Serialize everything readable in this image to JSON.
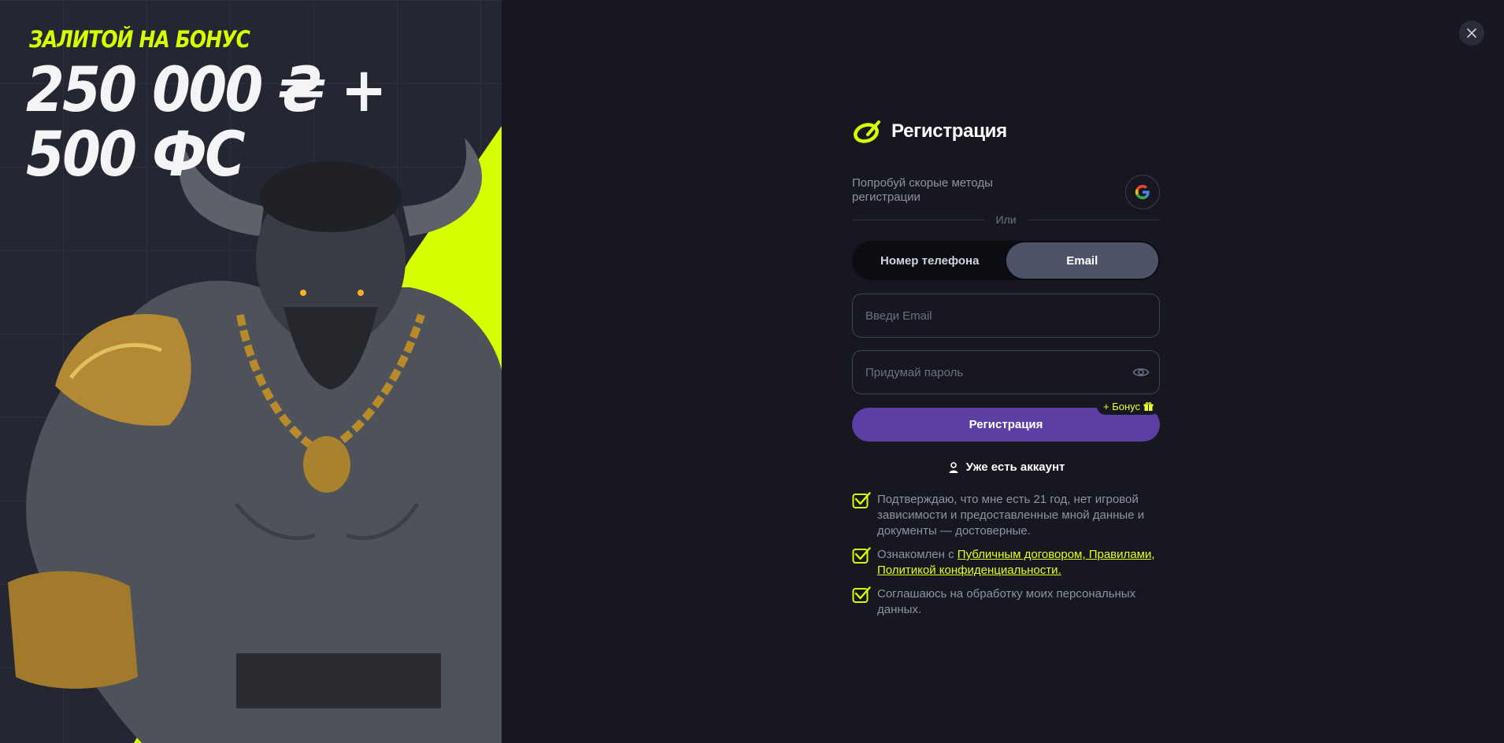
{
  "promo": {
    "kicker": "ЗАЛИТОЙ НА БОНУС",
    "amount_line1": "250 000 ₴ +",
    "amount_line2": "500 ФС"
  },
  "close_icon": "close-icon",
  "form": {
    "title": "Регистрация",
    "social_text": "Попробуй скорые методы регистрации",
    "social_icon": "google-icon",
    "divider_text": "Или",
    "tabs": [
      {
        "label": "Номер телефона",
        "active": false
      },
      {
        "label": "Email",
        "active": true
      }
    ],
    "email_placeholder": "Введи Email",
    "password_placeholder": "Придумай пароль",
    "submit_label": "Регистрация",
    "bonus_badge": "+ Бонус",
    "account_link": "Уже есть аккаунт",
    "consents": {
      "age": "Подтверждаю, что мне есть 21 год, нет игровой зависимости и предоставленные мной данные и документы — достоверные.",
      "terms_prefix": "Ознакомлен с ",
      "terms_link": "Публичным договором, Правилами, Политикой конфиденциальности.",
      "personal_data": "Соглашаюсь на обработку моих персональных данных."
    }
  },
  "colors": {
    "accent": "#d6ff00",
    "submit": "#5b3fa5",
    "background": "#17181f",
    "promo_background": "#242632",
    "tab_active": "#4d5468"
  }
}
